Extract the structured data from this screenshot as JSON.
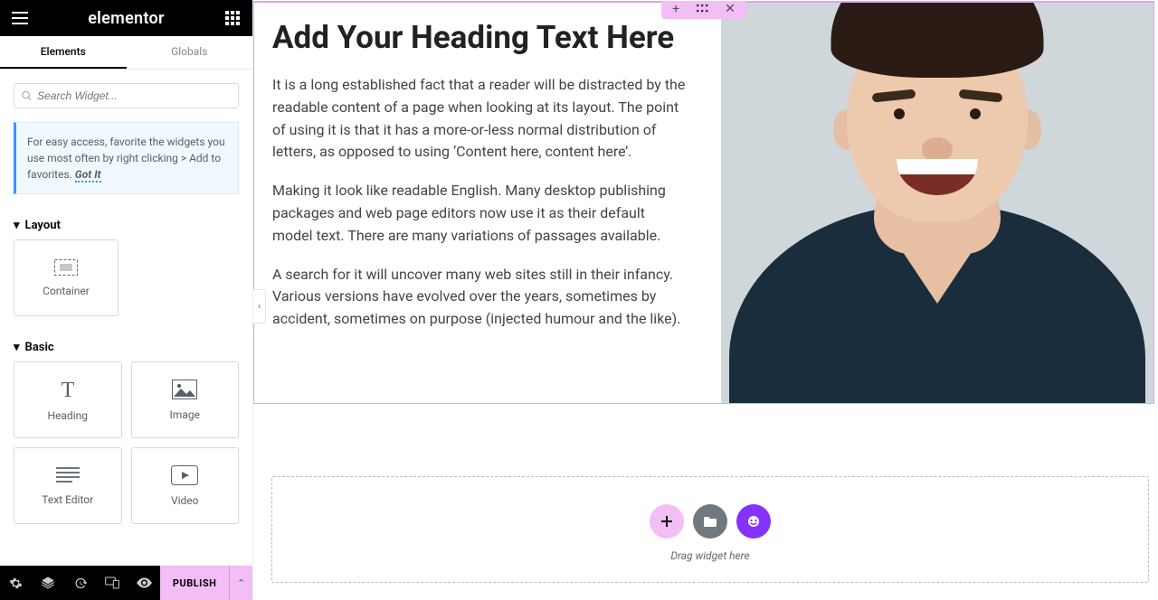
{
  "app": {
    "logo": "elementor"
  },
  "tabs": {
    "elements": "Elements",
    "globals": "Globals"
  },
  "search": {
    "placeholder": "Search Widget..."
  },
  "tip": {
    "text": "For easy access, favorite the widgets you use most often by right clicking > Add to favorites.",
    "action": "Got It"
  },
  "sections": {
    "layout": "Layout",
    "basic": "Basic"
  },
  "widgets": {
    "container": "Container",
    "heading": "Heading",
    "image": "Image",
    "text_editor": "Text Editor",
    "video": "Video"
  },
  "publish": "PUBLISH",
  "content": {
    "heading": "Add Your Heading Text Here",
    "p1": "It is a long established fact that a reader will be distracted by the readable content of a page when looking at its layout. The point of using it is that it has a more-or-less normal distribution of letters, as opposed to using ‘Content here, content here’.",
    "p2": "Making it look like readable English. Many desktop publishing packages and web page editors now use it as their default model text. There are many variations of passages available.",
    "p3": "A search for it will uncover many web sites still in their infancy. Various versions have evolved over the years, sometimes by accident, sometimes on purpose (injected humour and the like)."
  },
  "dropzone": {
    "text": "Drag widget here"
  },
  "icons": {
    "plus": "+",
    "drag": "⁙",
    "close": "✕",
    "caret_down": "▾",
    "caret_up": "⌃",
    "caret_left": "‹"
  }
}
